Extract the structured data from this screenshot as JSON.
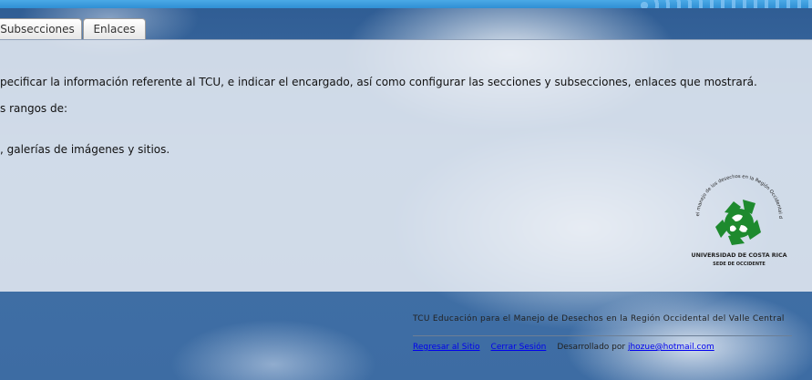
{
  "tabs": [
    {
      "label": "Subsecciones"
    },
    {
      "label": "Enlaces"
    }
  ],
  "content": {
    "line1": "pecificar la información referente al TCU, e indicar el encargado, así como configurar las secciones y subsecciones, enlaces que mostrará.",
    "line2": "s rangos de:",
    "line3": ", galerías de imágenes y sitios."
  },
  "logo": {
    "arc_text": "Educación para el manejo de los desechos en la Región Occidental del Valle Central",
    "university": "UNIVERSIDAD DE COSTA RICA",
    "campus": "SEDE DE OCCIDENTE",
    "color": "#1e8a2e"
  },
  "footer": {
    "title": "TCU Educación para el Manejo de Desechos en la Región Occidental del Valle Central",
    "back_link": "Regresar al Sitio",
    "logout_link": "Cerrar Sesión",
    "developed_by": "Desarrollado por",
    "email_link": "jhozue@hotmail.com"
  }
}
